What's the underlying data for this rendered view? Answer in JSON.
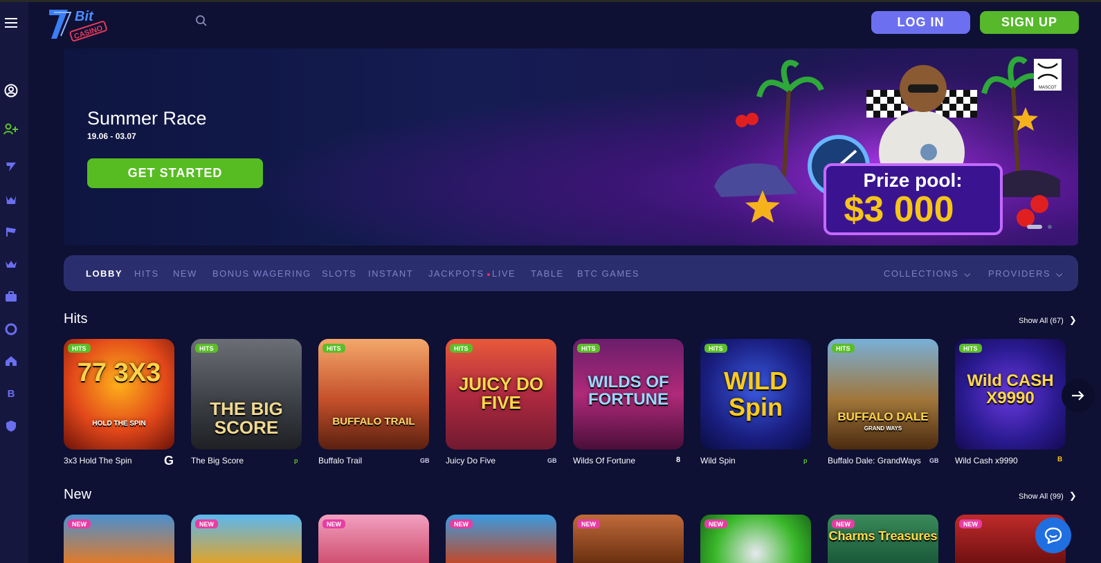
{
  "header": {
    "brand_logo_text": "7Bit CASINO",
    "login_label": "LOG IN",
    "signup_label": "SIGN UP"
  },
  "sidebar": {
    "icons": [
      "menu-icon",
      "user-icon",
      "user-plus-icon",
      "lightning-7-icon",
      "trophy-icon",
      "flag-icon",
      "crown-icon",
      "briefcase-icon",
      "lifebuoy-icon",
      "home-icon",
      "bitcoin-icon",
      "shield-icon"
    ]
  },
  "banner": {
    "title": "Summer Race",
    "dates": "19.06 - 03.07",
    "cta_label": "GET STARTED",
    "prize_label": "Prize pool:",
    "prize_amount": "$3 000",
    "provider_logo_text": "MASCOT"
  },
  "nav": {
    "items": [
      "LOBBY",
      "HITS",
      "NEW",
      "BONUS WAGERING",
      "SLOTS",
      "INSTANT",
      "JACKPOTS",
      "LIVE",
      "TABLE",
      "BTC GAMES"
    ],
    "collections_label": "COLLECTIONS",
    "providers_label": "PROVIDERS"
  },
  "hits": {
    "title": "Hits",
    "show_all": "Show All (67)",
    "badge": "HITS",
    "games": [
      {
        "name": "3x3 Hold The Spin",
        "provider": "G",
        "art": "77 3X3",
        "art_sub": "HOLD THE SPIN"
      },
      {
        "name": "The Big Score",
        "provider": "p",
        "art": "THE BIG SCORE",
        "art_sub": ""
      },
      {
        "name": "Buffalo Trail",
        "provider": "GB",
        "art": "BUFFALO TRAIL",
        "art_sub": ""
      },
      {
        "name": "Juicy Do Five",
        "provider": "GB",
        "art": "JUICY DO FIVE",
        "art_sub": ""
      },
      {
        "name": "Wilds Of Fortune",
        "provider": "8",
        "art": "WILDS OF FORTUNE",
        "art_sub": ""
      },
      {
        "name": "Wild Spin",
        "provider": "p",
        "art": "WILD Spin",
        "art_sub": ""
      },
      {
        "name": "Buffalo Dale: GrandWays",
        "provider": "GB",
        "art": "BUFFALO DALE",
        "art_sub": "GRAND WAYS"
      },
      {
        "name": "Wild Cash x9990",
        "provider": "B",
        "art": "Wild CASH X9990",
        "art_sub": ""
      }
    ]
  },
  "new_section": {
    "title": "New",
    "show_all": "Show All (99)",
    "badge": "NEW",
    "cards": [
      "",
      "",
      "",
      "",
      "",
      "",
      "Charms Treasures",
      ""
    ]
  }
}
